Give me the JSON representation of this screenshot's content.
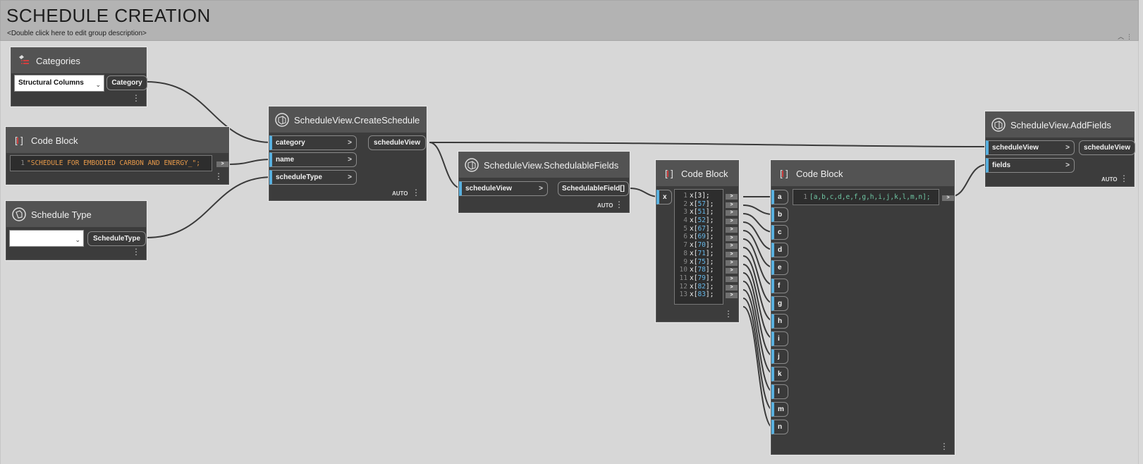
{
  "group": {
    "title": "SCHEDULE CREATION",
    "description": "<Double click here to edit group description>"
  },
  "colors": {
    "port_accent": "#58b0df",
    "node_bg": "#3c3c3c",
    "node_header": "#535353",
    "canvas": "#d7d7d7"
  },
  "nodes": {
    "categories": {
      "title": "Categories",
      "icon": "category-icon",
      "dropdown_value": "Structural Columns",
      "output": "Category"
    },
    "code_block_1": {
      "title": "Code Block",
      "icon": "code-block-icon",
      "line_no": "1",
      "code": "\"SCHEDULE FOR EMBODIED CARBON AND ENERGY_\";",
      "out_glyph": ">"
    },
    "schedule_type": {
      "title": "Schedule Type",
      "icon": "schedule-type-icon",
      "dropdown_value": "",
      "output": "ScheduleType"
    },
    "create_schedule": {
      "title": "ScheduleView.CreateSchedule",
      "icon": "schedule-view-icon",
      "inputs": [
        "category",
        "name",
        "scheduleType"
      ],
      "output": "scheduleView",
      "lacing": "AUTO"
    },
    "schedulable_fields": {
      "title": "ScheduleView.SchedulableFields",
      "icon": "schedule-view-icon",
      "input": "scheduleView",
      "output": "SchedulableField[]",
      "lacing": "AUTO"
    },
    "code_block_2": {
      "title": "Code Block",
      "icon": "code-block-icon",
      "input": "x",
      "lines": [
        {
          "n": "1",
          "pre": "x",
          "idx": "3"
        },
        {
          "n": "2",
          "pre": "x[",
          "idx": "57"
        },
        {
          "n": "3",
          "pre": "x[",
          "idx": "51"
        },
        {
          "n": "4",
          "pre": "x[",
          "idx": "52"
        },
        {
          "n": "5",
          "pre": "x[",
          "idx": "67"
        },
        {
          "n": "6",
          "pre": "x[",
          "idx": "69"
        },
        {
          "n": "7",
          "pre": "x[",
          "idx": "70"
        },
        {
          "n": "8",
          "pre": "x[",
          "idx": "71"
        },
        {
          "n": "9",
          "pre": "x[",
          "idx": "75"
        },
        {
          "n": "10",
          "pre": "x[",
          "idx": "78"
        },
        {
          "n": "11",
          "pre": "x[",
          "idx": "79"
        },
        {
          "n": "12",
          "pre": "x[",
          "idx": "82"
        },
        {
          "n": "13",
          "pre": "x[",
          "idx": "83"
        }
      ],
      "out_glyph": ">"
    },
    "code_block_3": {
      "title": "Code Block",
      "icon": "code-block-icon",
      "inputs": [
        "a",
        "b",
        "c",
        "d",
        "e",
        "f",
        "g",
        "h",
        "i",
        "j",
        "k",
        "l",
        "m",
        "n"
      ],
      "line_no": "1",
      "code": "[a,b,c,d,e,f,g,h,i,j,k,l,m,n];",
      "out_glyph": ">"
    },
    "add_fields": {
      "title": "ScheduleView.AddFields",
      "icon": "schedule-view-icon",
      "inputs": [
        "scheduleView",
        "fields"
      ],
      "output": "scheduleView",
      "lacing": "AUTO"
    }
  }
}
